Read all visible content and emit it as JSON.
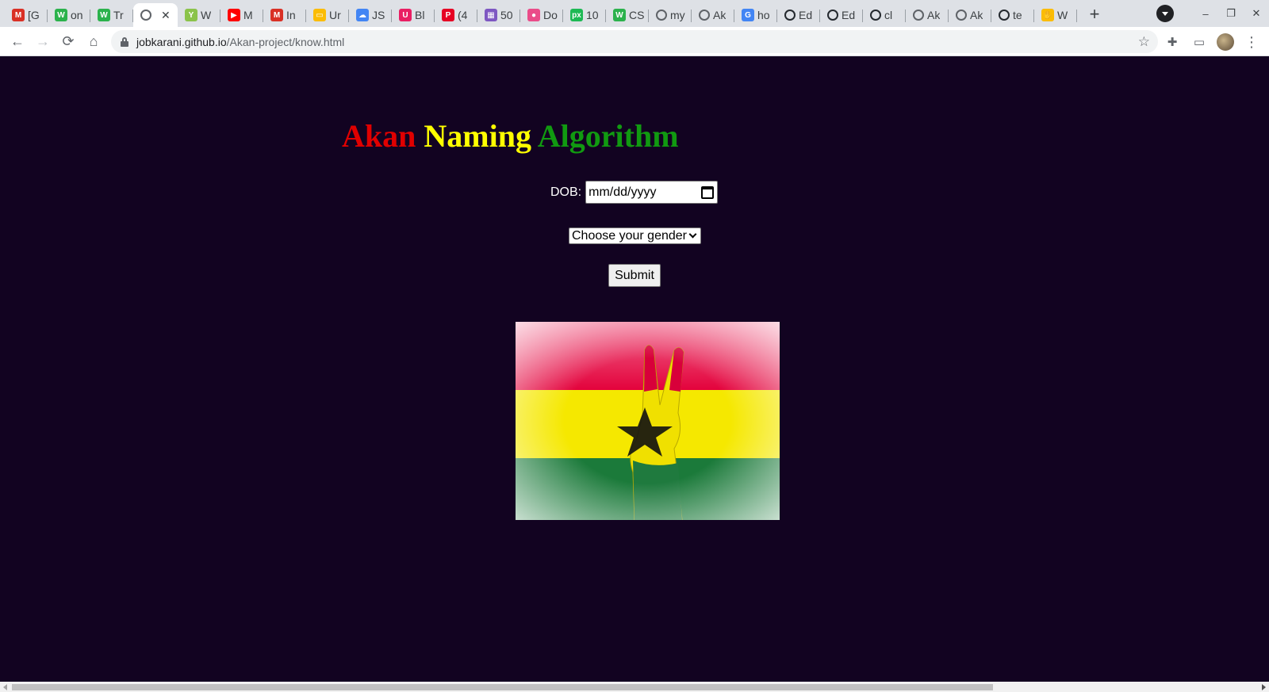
{
  "browser": {
    "tabs": [
      {
        "title": "[G",
        "icon": "gmail-icon",
        "color": "#d93025",
        "glyph": "M"
      },
      {
        "title": "on",
        "icon": "w-icon",
        "color": "#2bb24c",
        "glyph": "W"
      },
      {
        "title": "Tr",
        "icon": "w-icon",
        "color": "#2bb24c",
        "glyph": "W"
      },
      {
        "title": "",
        "icon": "globe-icon",
        "color": "#5f6368",
        "glyph": "",
        "active": true
      },
      {
        "title": "W",
        "icon": "tree-icon",
        "color": "#8bc34a",
        "glyph": "Y"
      },
      {
        "title": "M",
        "icon": "youtube-icon",
        "color": "#ff0000",
        "glyph": "▶"
      },
      {
        "title": "In",
        "icon": "gmail-icon",
        "color": "#d93025",
        "glyph": "M"
      },
      {
        "title": "Ur",
        "icon": "note-icon",
        "color": "#fbbc04",
        "glyph": "▭"
      },
      {
        "title": "JS",
        "icon": "cloud-icon",
        "color": "#4285f4",
        "glyph": "☁"
      },
      {
        "title": "Bl",
        "icon": "cup-icon",
        "color": "#e91e63",
        "glyph": "U"
      },
      {
        "title": "(4",
        "icon": "pinterest-icon",
        "color": "#e60023",
        "glyph": "P"
      },
      {
        "title": "50",
        "icon": "grid-icon",
        "color": "#7e57c2",
        "glyph": "▦"
      },
      {
        "title": "Do",
        "icon": "dribbble-icon",
        "color": "#ea4c89",
        "glyph": "●"
      },
      {
        "title": "10",
        "icon": "px-icon",
        "color": "#1db954",
        "glyph": "px"
      },
      {
        "title": "CS",
        "icon": "w-icon",
        "color": "#2bb24c",
        "glyph": "W"
      },
      {
        "title": "my",
        "icon": "globe-icon",
        "color": "#5f6368",
        "glyph": ""
      },
      {
        "title": "Ak",
        "icon": "globe-icon",
        "color": "#5f6368",
        "glyph": ""
      },
      {
        "title": "ho",
        "icon": "google-icon",
        "color": "#4285f4",
        "glyph": "G"
      },
      {
        "title": "Ed",
        "icon": "github-icon",
        "color": "#24292e",
        "glyph": ""
      },
      {
        "title": "Ed",
        "icon": "github-icon",
        "color": "#24292e",
        "glyph": ""
      },
      {
        "title": "cl",
        "icon": "github-icon",
        "color": "#24292e",
        "glyph": ""
      },
      {
        "title": "Ak",
        "icon": "globe-icon",
        "color": "#5f6368",
        "glyph": ""
      },
      {
        "title": "Ak",
        "icon": "globe-icon",
        "color": "#5f6368",
        "glyph": ""
      },
      {
        "title": "te",
        "icon": "github-icon",
        "color": "#24292e",
        "glyph": ""
      },
      {
        "title": "W",
        "icon": "hand-icon",
        "color": "#fbbc04",
        "glyph": "✋"
      }
    ],
    "close_tab_glyph": "✕",
    "new_tab_glyph": "+",
    "window_controls": {
      "minimize": "–",
      "restore": "❐",
      "close": "✕"
    },
    "nav": {
      "back": "←",
      "forward": "→",
      "reload": "⟳",
      "home": "⌂"
    },
    "url_host": "jobkarani.github.io",
    "url_path": "/Akan-project/know.html",
    "bookmark_star": "☆",
    "extensions_glyph": "✚",
    "cast_glyph": "▭",
    "menu_glyph": "⋮"
  },
  "page": {
    "title_words": [
      "Akan",
      "Naming",
      "Algorithm"
    ],
    "dob_label": "DOB:",
    "dob_placeholder": "mm/dd/yyyy",
    "gender_selected": "Choose your gender",
    "submit_label": "Submit",
    "background_color": "#120321",
    "flag_colors": {
      "red": "#e3003a",
      "yellow": "#f5e800",
      "green": "#1b7a3a"
    }
  }
}
